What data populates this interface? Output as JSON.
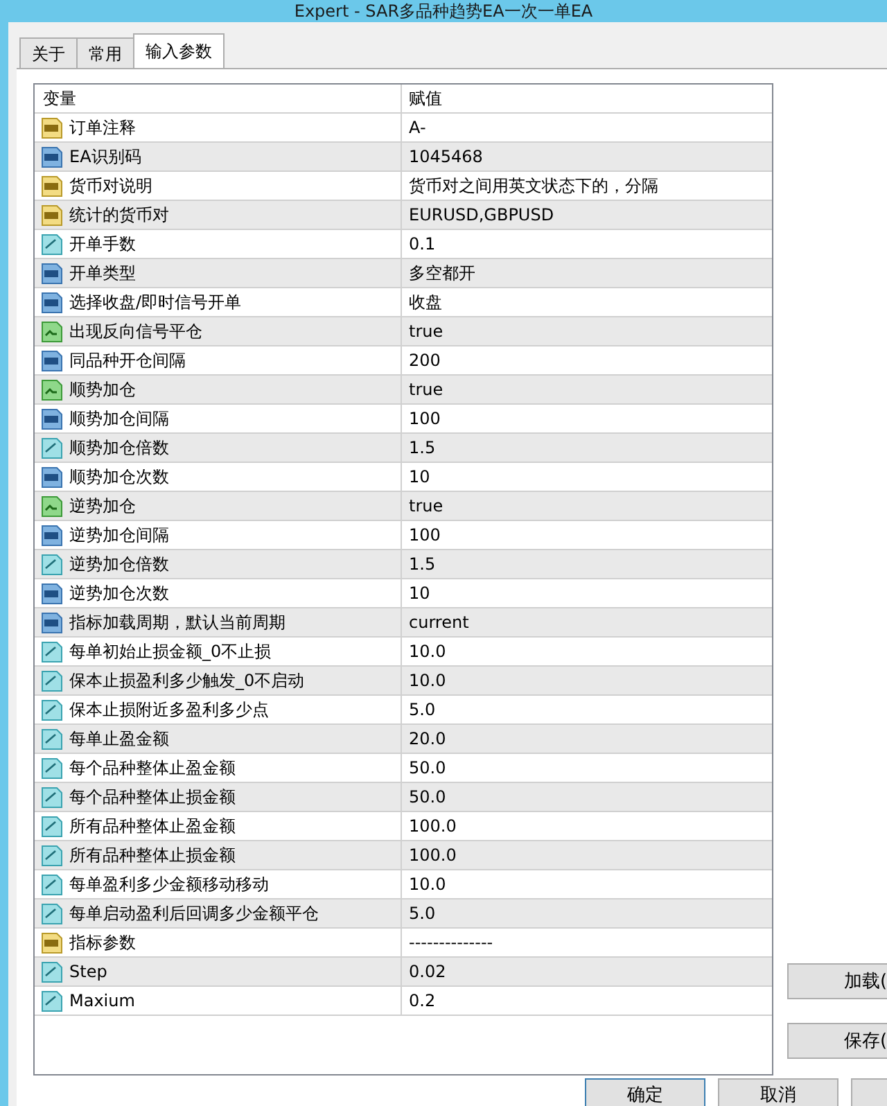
{
  "window": {
    "title": "Expert - SAR多品种趋势EA一次一单EA"
  },
  "tabs": [
    {
      "label": "关于",
      "selected": false
    },
    {
      "label": "常用",
      "selected": false
    },
    {
      "label": "输入参数",
      "selected": true
    }
  ],
  "table": {
    "columns": [
      "变量",
      "赋值"
    ],
    "rows": [
      {
        "kind": "text",
        "name": "订单注释",
        "value": "A-"
      },
      {
        "kind": "int",
        "name": "EA识别码",
        "value": "1045468"
      },
      {
        "kind": "text",
        "name": "货币对说明",
        "value": "货币对之间用英文状态下的，分隔"
      },
      {
        "kind": "text",
        "name": "统计的货币对",
        "value": "EURUSD,GBPUSD"
      },
      {
        "kind": "double",
        "name": "开单手数",
        "value": "0.1"
      },
      {
        "kind": "int",
        "name": "开单类型",
        "value": "多空都开"
      },
      {
        "kind": "int",
        "name": "选择收盘/即时信号开单",
        "value": "收盘"
      },
      {
        "kind": "bool",
        "name": "出现反向信号平仓",
        "value": "true"
      },
      {
        "kind": "int",
        "name": "同品种开仓间隔",
        "value": "200"
      },
      {
        "kind": "bool",
        "name": "顺势加仓",
        "value": "true"
      },
      {
        "kind": "int",
        "name": "顺势加仓间隔",
        "value": "100"
      },
      {
        "kind": "double",
        "name": "顺势加仓倍数",
        "value": "1.5"
      },
      {
        "kind": "int",
        "name": "顺势加仓次数",
        "value": "10"
      },
      {
        "kind": "bool",
        "name": "逆势加仓",
        "value": "true"
      },
      {
        "kind": "int",
        "name": "逆势加仓间隔",
        "value": "100"
      },
      {
        "kind": "double",
        "name": "逆势加仓倍数",
        "value": "1.5"
      },
      {
        "kind": "int",
        "name": "逆势加仓次数",
        "value": "10"
      },
      {
        "kind": "int",
        "name": "指标加载周期，默认当前周期",
        "value": "current"
      },
      {
        "kind": "double",
        "name": "每单初始止损金额_0不止损",
        "value": "10.0"
      },
      {
        "kind": "double",
        "name": "保本止损盈利多少触发_0不启动",
        "value": "10.0"
      },
      {
        "kind": "double",
        "name": "保本止损附近多盈利多少点",
        "value": "5.0"
      },
      {
        "kind": "double",
        "name": "每单止盈金额",
        "value": "20.0"
      },
      {
        "kind": "double",
        "name": "每个品种整体止盈金额",
        "value": "50.0"
      },
      {
        "kind": "double",
        "name": "每个品种整体止损金额",
        "value": "50.0"
      },
      {
        "kind": "double",
        "name": "所有品种整体止盈金额",
        "value": "100.0"
      },
      {
        "kind": "double",
        "name": "所有品种整体止损金额",
        "value": "100.0"
      },
      {
        "kind": "double",
        "name": "每单盈利多少金额移动移动",
        "value": "10.0"
      },
      {
        "kind": "double",
        "name": "每单启动盈利后回调多少金额平仓",
        "value": "5.0"
      },
      {
        "kind": "text",
        "name": "指标参数",
        "value": "--------------"
      },
      {
        "kind": "double",
        "name": "Step",
        "value": "0.02"
      },
      {
        "kind": "double",
        "name": "Maxium",
        "value": "0.2"
      }
    ]
  },
  "side_buttons": [
    "加载(",
    "保存("
  ],
  "buttons": [
    "确定",
    "取消"
  ]
}
